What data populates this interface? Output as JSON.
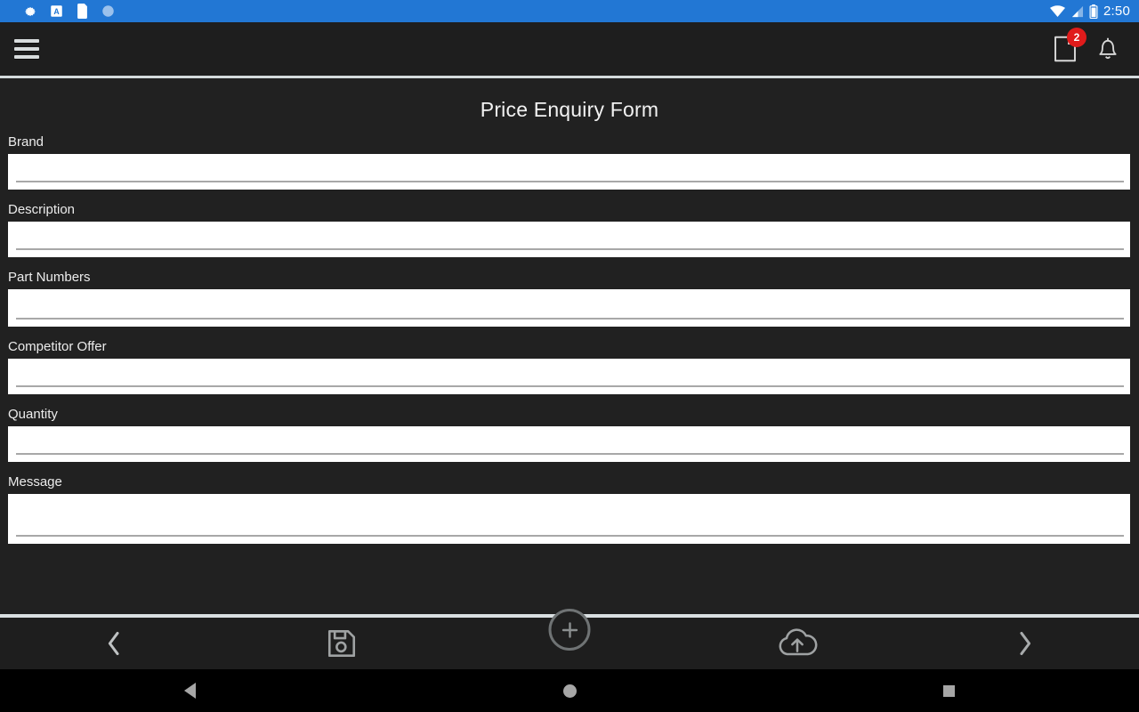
{
  "status_bar": {
    "background": "#2277d4",
    "left_icons": [
      "gear-icon",
      "font-a-icon",
      "sd-card-icon",
      "circle-icon"
    ],
    "right_icons": [
      "wifi-icon",
      "cell-signal-icon",
      "battery-icon"
    ],
    "time": "2:50"
  },
  "app_bar": {
    "menu_icon": "hamburger-menu-icon",
    "note_icon": "note-document-icon",
    "note_badge_count": "2",
    "badge_color": "#e01b1b",
    "bell_icon": "notification-bell-icon"
  },
  "form": {
    "title": "Price Enquiry Form",
    "fields": [
      {
        "label": "Brand",
        "value": "",
        "placeholder": "",
        "type": "input",
        "size": "std"
      },
      {
        "label": "Description",
        "value": "",
        "placeholder": "",
        "type": "input",
        "size": "std"
      },
      {
        "label": "Part Numbers",
        "value": "",
        "placeholder": "",
        "type": "input",
        "size": "mid"
      },
      {
        "label": "Competitor Offer",
        "value": "",
        "placeholder": "",
        "type": "input",
        "size": "std"
      },
      {
        "label": "Quantity",
        "value": "",
        "placeholder": "",
        "type": "input",
        "size": "std"
      },
      {
        "label": "Message",
        "value": "",
        "placeholder": "",
        "type": "textarea",
        "size": "big"
      }
    ]
  },
  "toolbar": {
    "prev_label": "previous",
    "prev_icon": "chevron-left-icon",
    "save_label": "save",
    "save_icon": "floppy-disk-save-icon",
    "add_label": "add",
    "add_icon": "plus-circle-icon",
    "upload_label": "upload",
    "upload_icon": "cloud-upload-icon",
    "next_label": "next",
    "next_icon": "chevron-right-icon"
  },
  "nav_bar": {
    "back_icon": "android-back-icon",
    "home_icon": "android-home-icon",
    "recents_icon": "android-recents-icon"
  },
  "colors": {
    "accent": "#2277d4",
    "page_bg": "#212121",
    "bar_bg": "#1e1e1e",
    "field_bg": "#ffffff",
    "divider": "#d4dadc"
  }
}
